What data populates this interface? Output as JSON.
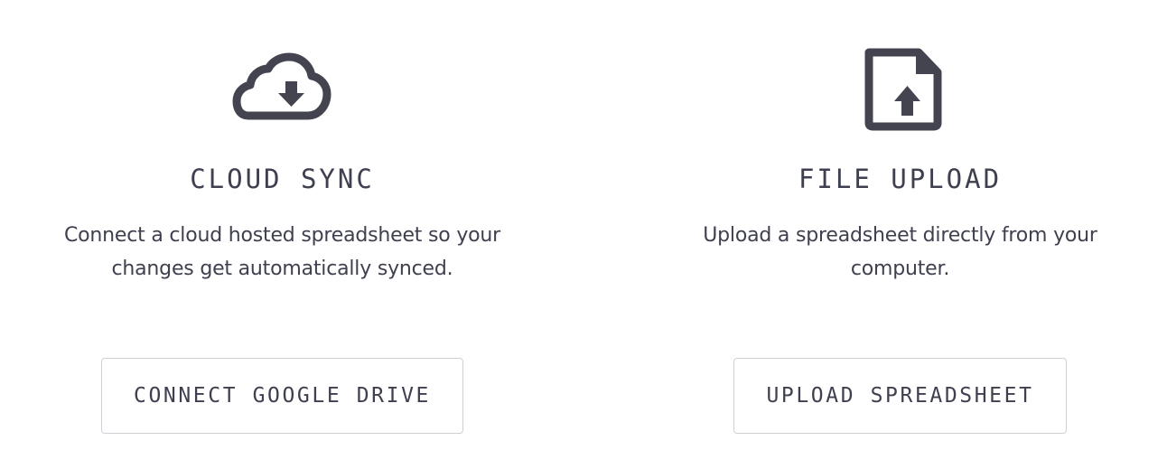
{
  "cards": [
    {
      "icon": "cloud-download-icon",
      "title": "CLOUD SYNC",
      "description_lines": [
        "Connect a cloud hosted spreadsheet so your",
        "changes get automatically synced."
      ],
      "button_label": "CONNECT GOOGLE DRIVE"
    },
    {
      "icon": "file-upload-icon",
      "title": "FILE UPLOAD",
      "description_lines": [
        "Upload a spreadsheet directly from your",
        "computer."
      ],
      "button_label": "UPLOAD SPREADSHEET"
    }
  ],
  "colors": {
    "text": "#3f404f",
    "icon": "#43444f",
    "button_border": "#cfd0d6",
    "background": "#ffffff"
  }
}
